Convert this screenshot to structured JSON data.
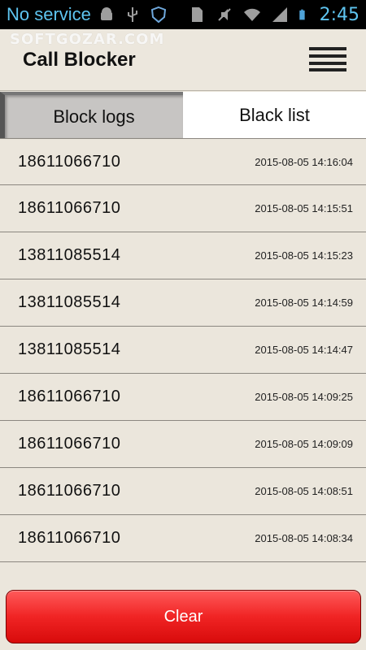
{
  "status_bar": {
    "carrier": "No service",
    "time": "2:45",
    "icons": [
      "android-debug-icon",
      "usb-icon",
      "shield-icon",
      "sim-icon",
      "mute-icon",
      "wifi-icon",
      "signal-icon",
      "battery-icon"
    ]
  },
  "watermark": "SOFTGOZAR.COM",
  "app": {
    "title": "Call Blocker",
    "menu_icon": "menu-icon"
  },
  "tabs": [
    {
      "label": "Block logs",
      "active": true
    },
    {
      "label": "Black list",
      "active": false
    }
  ],
  "logs": [
    {
      "number": "18611066710",
      "time": "2015-08-05 14:16:04"
    },
    {
      "number": "18611066710",
      "time": "2015-08-05 14:15:51"
    },
    {
      "number": "13811085514",
      "time": "2015-08-05 14:15:23"
    },
    {
      "number": "13811085514",
      "time": "2015-08-05 14:14:59"
    },
    {
      "number": "13811085514",
      "time": "2015-08-05 14:14:47"
    },
    {
      "number": "18611066710",
      "time": "2015-08-05 14:09:25"
    },
    {
      "number": "18611066710",
      "time": "2015-08-05 14:09:09"
    },
    {
      "number": "18611066710",
      "time": "2015-08-05 14:08:51"
    },
    {
      "number": "18611066710",
      "time": "2015-08-05 14:08:34"
    }
  ],
  "clear_label": "Clear",
  "colors": {
    "clear_button": "#e81818",
    "status_text": "#5ec4f0",
    "background": "#ebe6dc"
  }
}
